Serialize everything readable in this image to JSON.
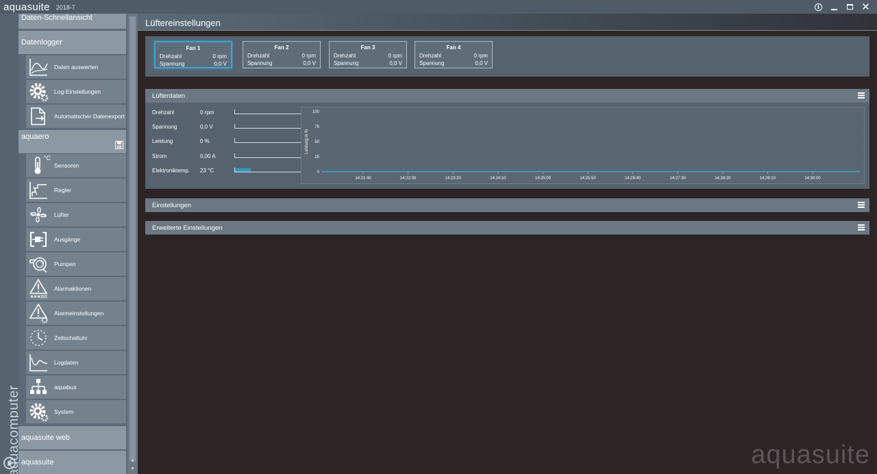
{
  "titlebar": {
    "app_name": "aquasuite",
    "version": "2018-7",
    "info_label": "i"
  },
  "brand": {
    "vertical_text": "aquacomputer"
  },
  "sidebar": {
    "sections": [
      {
        "label": "Daten-Schnellansicht"
      },
      {
        "label": "Datenlogger"
      },
      {
        "label": "aquaero"
      },
      {
        "label": "aquasuite web"
      },
      {
        "label": "aquasuite"
      }
    ],
    "datenlogger_items": [
      {
        "label": "Daten auswerten",
        "icon": "chart-curve-icon"
      },
      {
        "label": "Log-Einstellungen",
        "icon": "gear-icon"
      },
      {
        "label": "Automatischer Datenexport",
        "icon": "export-document-icon"
      }
    ],
    "aquaero_items": [
      {
        "label": "Sensoren",
        "icon": "thermometer-icon"
      },
      {
        "label": "Regler",
        "icon": "controller-icon"
      },
      {
        "label": "Lüfter",
        "icon": "fan-icon"
      },
      {
        "label": "Ausgänge",
        "icon": "plug-icon"
      },
      {
        "label": "Pumpen",
        "icon": "pump-icon"
      },
      {
        "label": "Alarmaktionen",
        "icon": "alarm-actions-icon"
      },
      {
        "label": "Alarmeinstellungen",
        "icon": "alarm-settings-icon"
      },
      {
        "label": "Zeitschaltuhr",
        "icon": "timer-icon"
      },
      {
        "label": "Logdaten",
        "icon": "log-chart-icon"
      },
      {
        "label": "aquabus",
        "icon": "network-icon"
      },
      {
        "label": "System",
        "icon": "gear-icon"
      }
    ],
    "thermo_unit": "°C"
  },
  "main": {
    "page_title": "Lüftereinstellungen",
    "fans": [
      {
        "name": "Fan 1",
        "rpm_label": "Drehzahl",
        "rpm": "0 rpm",
        "volt_label": "Spannung",
        "volt": "0,0 V",
        "selected": true
      },
      {
        "name": "Fan 2",
        "rpm_label": "Drehzahl",
        "rpm": "0 rpm",
        "volt_label": "Spannung",
        "volt": "0,0 V",
        "selected": false
      },
      {
        "name": "Fan 3",
        "rpm_label": "Drehzahl",
        "rpm": "0 rpm",
        "volt_label": "Spannung",
        "volt": "0,0 V",
        "selected": false
      },
      {
        "name": "Fan 4",
        "rpm_label": "Drehzahl",
        "rpm": "0 rpm",
        "volt_label": "Spannung",
        "volt": "0,0 V",
        "selected": false
      }
    ],
    "panels": {
      "fan_data": "Lüfterdaten",
      "settings": "Einstellungen",
      "advanced": "Erweiterte Einstellungen"
    },
    "metrics": [
      {
        "label": "Drehzahl",
        "value": "0 rpm",
        "fraction": 0
      },
      {
        "label": "Spannung",
        "value": "0,0 V",
        "fraction": 0
      },
      {
        "label": "Leistung",
        "value": "0 %",
        "fraction": 0
      },
      {
        "label": "Strom",
        "value": "0,00 A",
        "fraction": 0
      },
      {
        "label": "Elektroniktemp.",
        "value": "23 °C",
        "fraction": 0.23
      }
    ],
    "accent_color": "#3ea1d4"
  },
  "chart_data": {
    "type": "line",
    "ylabel": "Leistung in %",
    "xlabel": "",
    "ylim": [
      0,
      100
    ],
    "yticks": [
      0,
      25,
      50,
      75,
      100
    ],
    "x": [
      "14:21:40",
      "14:22:30",
      "14:23:20",
      "14:24:10",
      "14:25:00",
      "14:25:50",
      "14:26:40",
      "14:27:30",
      "14:28:20",
      "14:29:10",
      "14:30:00"
    ],
    "series": [
      {
        "values": [
          0,
          0,
          0,
          0,
          0,
          0,
          0,
          0,
          0,
          0,
          0
        ]
      }
    ]
  },
  "watermark": "aquasuite"
}
